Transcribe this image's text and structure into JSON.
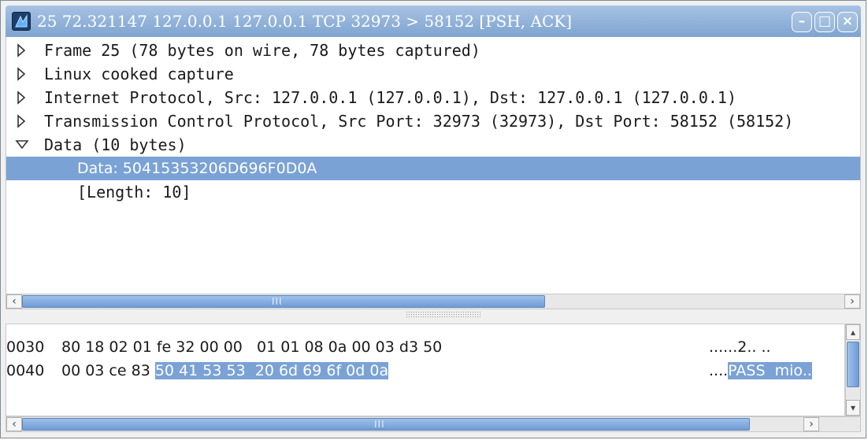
{
  "window": {
    "title": "25 72.321147 127.0.0.1 127.0.0.1 TCP 32973 > 58152 [PSH, ACK]",
    "buttons": {
      "minimize": "–",
      "maximize": "□",
      "close": "×"
    }
  },
  "tree": {
    "rows": [
      {
        "label": "Frame 25 (78 bytes on wire, 78 bytes captured)",
        "state": "collapsed"
      },
      {
        "label": "Linux cooked capture",
        "state": "collapsed"
      },
      {
        "label": "Internet Protocol, Src: 127.0.0.1 (127.0.0.1), Dst: 127.0.0.1 (127.0.0.1)",
        "state": "collapsed"
      },
      {
        "label": "Transmission Control Protocol, Src Port: 32973 (32973), Dst Port: 58152 (58152)",
        "state": "collapsed"
      },
      {
        "label": "Data (10 bytes)",
        "state": "expanded"
      }
    ],
    "children": [
      {
        "label": "Data: 50415353206D696F0D0A",
        "selected": true
      },
      {
        "label": "[Length: 10]",
        "selected": false
      }
    ]
  },
  "hex": {
    "lines": [
      {
        "offset": "0030",
        "bytes_a": "80 18 02 01 fe 32 00 00",
        "bytes_b": "01 01 08 0a 00 03 d3 50",
        "ascii": "......2.. .."
      },
      {
        "offset": "0040",
        "bytes_plain": "00 03 ce 83",
        "bytes_hl": "50 41 53 53  20 6d 69 6f 0d 0a",
        "ascii_plain": "....",
        "ascii_hl": "PASS  mio.."
      }
    ]
  },
  "scroll": {
    "grip": "III"
  },
  "colors": {
    "selection": "#7aa2d5",
    "titlebar": "#8fb0da"
  }
}
